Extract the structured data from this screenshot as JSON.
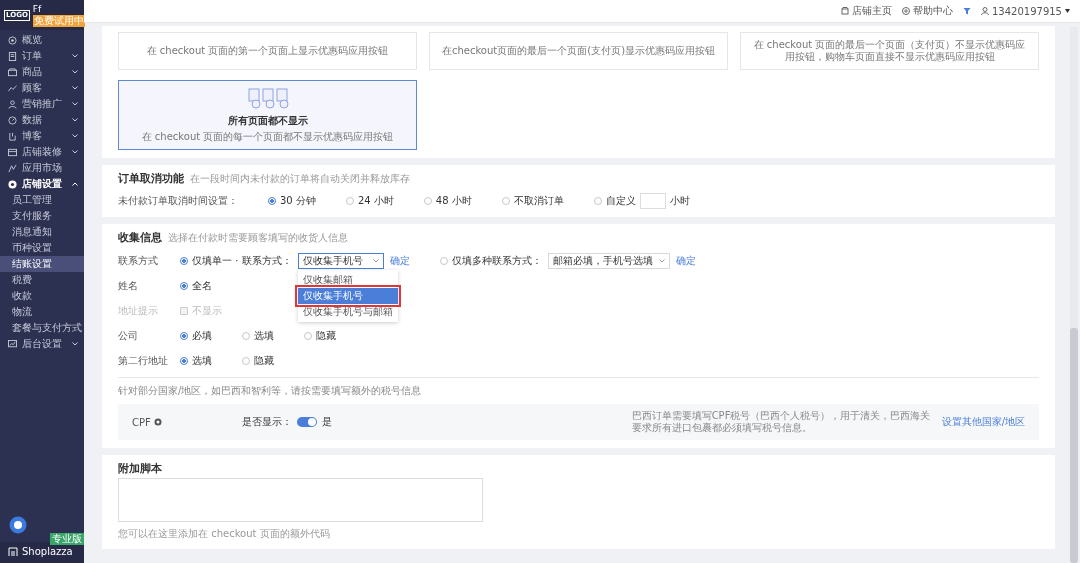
{
  "sidebar": {
    "logo": "LOGO",
    "store_name": "Ff",
    "plan_badge": "免费试用中",
    "items": [
      {
        "label": "概览",
        "kind": "link",
        "selected": false
      },
      {
        "label": "订单",
        "kind": "group",
        "expanded": false,
        "selected": false
      },
      {
        "label": "商品",
        "kind": "group",
        "expanded": false,
        "selected": false
      },
      {
        "label": "顾客",
        "kind": "group",
        "expanded": false,
        "selected": false
      },
      {
        "label": "营销推广",
        "kind": "group",
        "expanded": false,
        "selected": false
      },
      {
        "label": "数据",
        "kind": "group",
        "expanded": false,
        "selected": false
      },
      {
        "label": "博客",
        "kind": "group",
        "expanded": false,
        "selected": false
      },
      {
        "label": "店铺装修",
        "kind": "group",
        "expanded": false,
        "selected": false
      },
      {
        "label": "应用市场",
        "kind": "link",
        "selected": false
      },
      {
        "label": "店铺设置",
        "kind": "group",
        "expanded": true,
        "selected": false,
        "children": [
          {
            "label": "员工管理",
            "selected": false
          },
          {
            "label": "支付服务",
            "selected": false
          },
          {
            "label": "消息通知",
            "selected": false
          },
          {
            "label": "币种设置",
            "selected": false
          },
          {
            "label": "结账设置",
            "selected": true
          },
          {
            "label": "税费",
            "selected": false
          },
          {
            "label": "收款",
            "selected": false
          },
          {
            "label": "物流",
            "selected": false
          },
          {
            "label": "套餐与支付方式",
            "selected": false
          }
        ]
      },
      {
        "label": "后台设置",
        "kind": "group",
        "expanded": false,
        "selected": false
      }
    ],
    "brand": "Shoplazza",
    "brand_badge": "专业版"
  },
  "top_bar": {
    "links": [
      {
        "label": "店铺主页"
      },
      {
        "label": "帮助中心"
      }
    ],
    "user": "13420197915"
  },
  "discount_display": {
    "options": [
      {
        "description": "在 checkout 页面的第一个页面上显示优惠码应用按钮",
        "selected": false
      },
      {
        "description": "在checkout页面的最后一个页面(支付页)显示优惠码应用按钮",
        "selected": false
      },
      {
        "description": "在 checkout 页面的最后一个页面（支付页）不显示优惠码应用按钮，购物车页面直接不显示优惠码应用按钮",
        "selected": false
      },
      {
        "title": "所有页面都不显示",
        "description": "在 checkout 页面的每一个页面都不显示优惠码应用按钮",
        "selected": true
      }
    ]
  },
  "order_cancel": {
    "title": "订单取消功能",
    "description": "在一段时间内未付款的订单将自动关闭并释放库存",
    "label": "未付款订单取消时间设置：",
    "options": [
      {
        "label": "30 分钟",
        "kind": "preset",
        "selected": true
      },
      {
        "label": "24 小时",
        "kind": "preset",
        "selected": false
      },
      {
        "label": "48 小时",
        "kind": "preset",
        "selected": false
      },
      {
        "label": "不取消订单",
        "kind": "preset",
        "selected": false
      },
      {
        "label": "自定义",
        "kind": "custom",
        "unit": "小时",
        "selected": false
      }
    ]
  },
  "collect_info": {
    "title": "收集信息",
    "description": "选择在付款时需要顾客填写的收货人信息",
    "rows": [
      {
        "label": "联系方式",
        "disabled": false,
        "options": [
          {
            "kind": "radio",
            "label": "仅填单一 · 联系方式：",
            "selected": true,
            "select": {
              "value": "仅收集手机号",
              "open": true,
              "items": [
                {
                  "label": "仅收集邮箱",
                  "selected": false,
                  "annotated": false
                },
                {
                  "label": "仅收集手机号",
                  "selected": true,
                  "annotated": true
                },
                {
                  "label": "仅收集手机号与邮箱",
                  "selected": false,
                  "annotated": false
                }
              ]
            },
            "link": "确定"
          },
          {
            "kind": "radio",
            "label": "仅填多种联系方式：",
            "selected": false,
            "select": {
              "value": "邮箱必填，手机号选填",
              "open": false
            },
            "link": "确定"
          }
        ]
      },
      {
        "label": "姓名",
        "disabled": false,
        "options": [
          {
            "kind": "radio",
            "label": "全名",
            "selected": true
          }
        ]
      },
      {
        "label": "地址提示",
        "disabled": true,
        "options": [
          {
            "kind": "checkbox",
            "label": "不显示",
            "selected": false
          }
        ]
      },
      {
        "label": "公司",
        "disabled": false,
        "options": [
          {
            "kind": "radio",
            "label": "必填",
            "selected": true
          },
          {
            "kind": "radio",
            "label": "选填",
            "selected": false
          },
          {
            "kind": "radio",
            "label": "隐藏",
            "selected": false
          }
        ]
      },
      {
        "label": "第二行地址",
        "disabled": false,
        "options": [
          {
            "kind": "radio",
            "label": "选填",
            "selected": true
          },
          {
            "kind": "radio",
            "label": "隐藏",
            "selected": false
          }
        ]
      }
    ],
    "tax_note": "针对部分国家/地区，如巴西和智利等，请按需要填写额外的税号信息",
    "tax_rows": [
      {
        "field": "CPF",
        "show_label": "是否显示：",
        "on": true,
        "value_label": "是",
        "description": "巴西订单需要填写CPF税号（巴西个人税号），用于清关，巴西海关要求所有进口包裹都必须填写税号信息。",
        "link": "设置其他国家/地区"
      }
    ]
  },
  "script": {
    "title": "附加脚本",
    "hint": "您可以在这里添加在 checkout 页面的额外代码"
  }
}
